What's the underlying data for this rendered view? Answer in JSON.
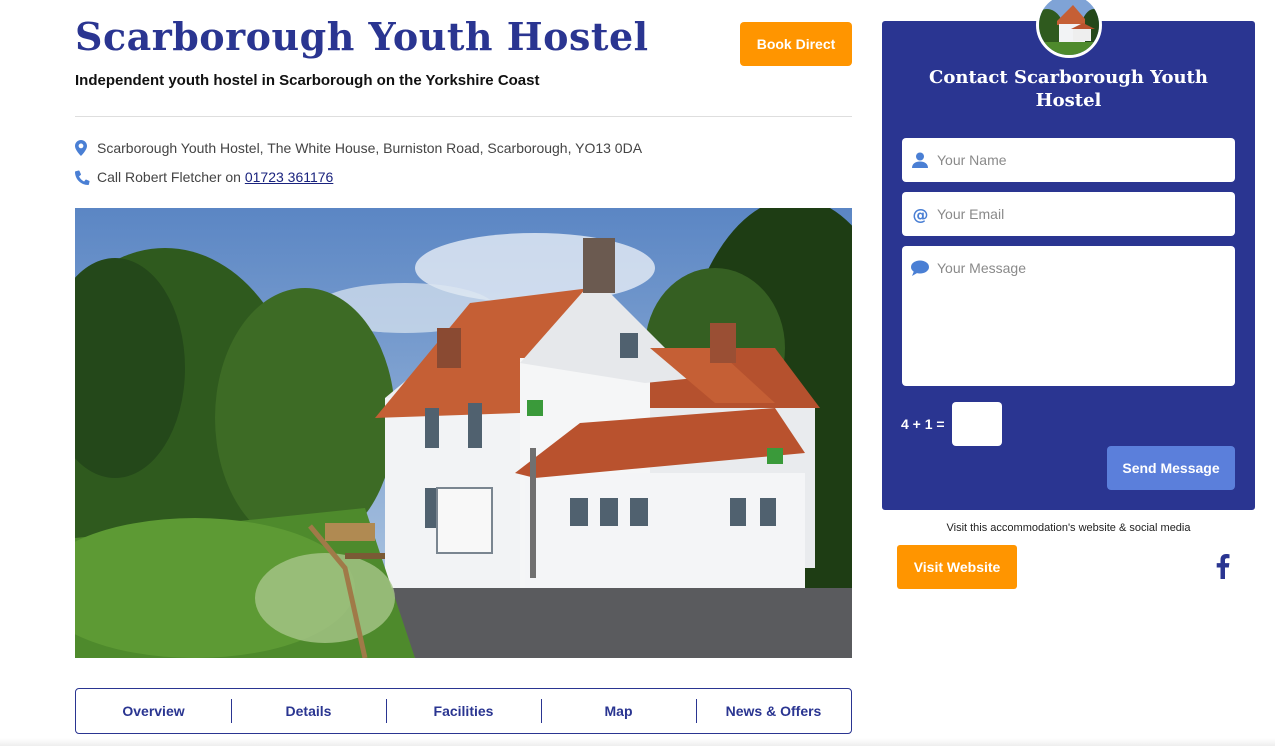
{
  "listing": {
    "title": "Scarborough Youth Hostel",
    "subtitle": "Independent youth hostel in Scarborough on the Yorkshire Coast",
    "book_label": "Book Direct",
    "address": "Scarborough Youth Hostel, The White House, Burniston Road, Scarborough, YO13 0DA",
    "call_prefix": "Call Robert Fletcher on",
    "phone": "01723 361176",
    "photo_icon": "hostel-photo"
  },
  "tabs": [
    {
      "label": "Overview"
    },
    {
      "label": "Details"
    },
    {
      "label": "Facilities"
    },
    {
      "label": "Map"
    },
    {
      "label": "News & Offers"
    }
  ],
  "contact": {
    "title": "Contact Scarborough Youth Hostel",
    "name_placeholder": "Your Name",
    "email_placeholder": "Your Email",
    "message_placeholder": "Your Message",
    "captcha_label": "4 + 1 =",
    "send_label": "Send Message"
  },
  "links": {
    "caption": "Visit this accommodation's website & social media",
    "visit_label": "Visit Website",
    "social_icon": "facebook-icon"
  },
  "colors": {
    "brand_navy": "#2a3591",
    "accent_orange": "#ff9500",
    "button_blue": "#5b7fdb",
    "icon_blue": "#4a7fd4"
  }
}
